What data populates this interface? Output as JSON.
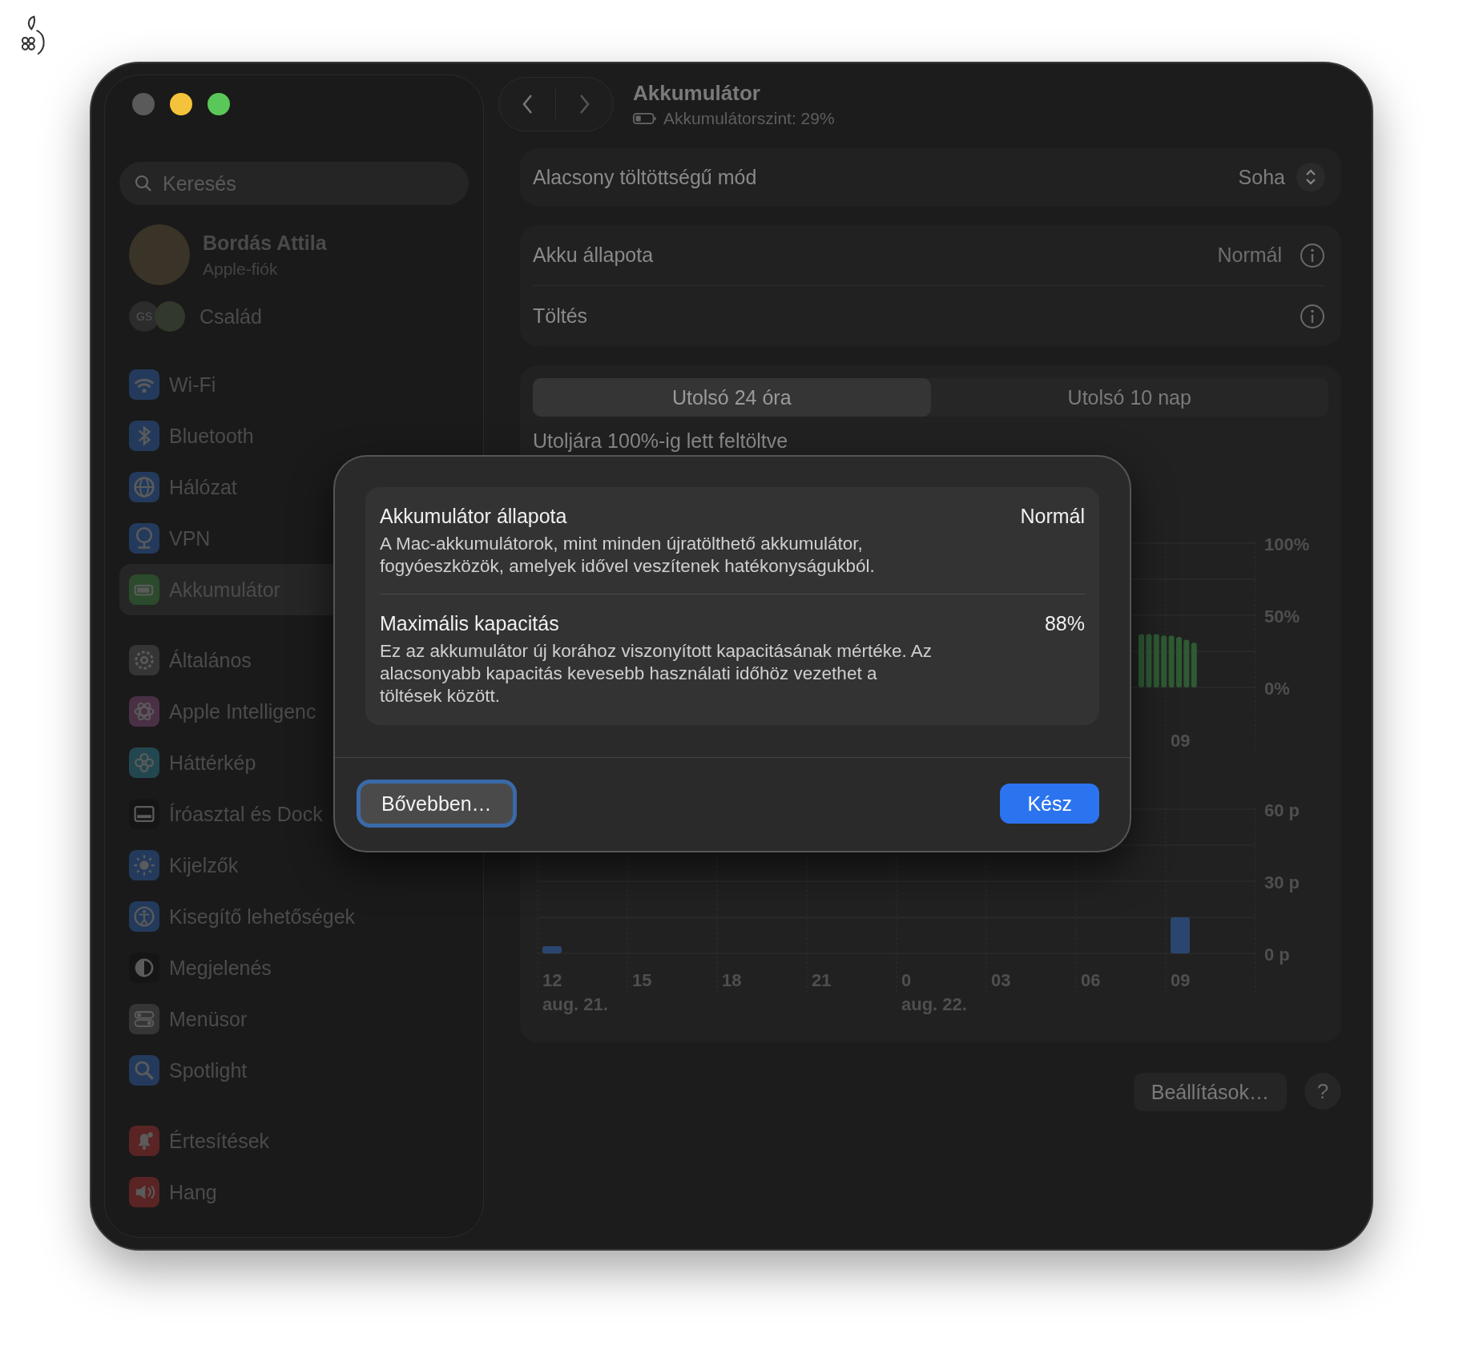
{
  "window": {
    "title": "Akkumulátor",
    "subtitle": "Akkumulátorszint: 29%"
  },
  "sidebar": {
    "search": {
      "placeholder": "Keresés"
    },
    "account": {
      "name": "Bordás Attila",
      "subtitle": "Apple-fiók"
    },
    "family": {
      "badge": "GS",
      "label": "Család"
    },
    "groups": [
      [
        {
          "label": "Wi-Fi",
          "selected": false
        },
        {
          "label": "Bluetooth",
          "selected": false
        },
        {
          "label": "Hálózat",
          "selected": false
        },
        {
          "label": "VPN",
          "selected": false
        },
        {
          "label": "Akkumulátor",
          "selected": true
        }
      ],
      [
        {
          "label": "Általános",
          "selected": false
        },
        {
          "label": "Apple Intelligenc",
          "selected": false
        },
        {
          "label": "Háttérkép",
          "selected": false
        },
        {
          "label": "Íróasztal és Dock",
          "selected": false
        },
        {
          "label": "Kijelzők",
          "selected": false
        },
        {
          "label": "Kisegítő lehetőségek",
          "selected": false
        },
        {
          "label": "Megjelenés",
          "selected": false
        },
        {
          "label": "Menüsor",
          "selected": false
        },
        {
          "label": "Spotlight",
          "selected": false
        }
      ],
      [
        {
          "label": "Értesítések",
          "selected": false
        },
        {
          "label": "Hang",
          "selected": false
        }
      ]
    ]
  },
  "low_power": {
    "label": "Alacsony töltöttségű mód",
    "value": "Soha"
  },
  "health_rows": [
    {
      "label": "Akku állapota",
      "value": "Normál"
    },
    {
      "label": "Töltés"
    }
  ],
  "range_tabs": [
    {
      "label": "Utolsó 24 óra",
      "selected": true
    },
    {
      "label": "Utolsó 10 nap",
      "selected": false
    }
  ],
  "last_charged": "Utoljára 100%-ig lett feltöltve",
  "battery_chart": {
    "chart_data": {
      "type": "bar",
      "series": [
        {
          "color": "#2f5a34",
          "values": [
            37,
            37,
            37,
            36,
            36,
            35,
            33,
            31
          ]
        }
      ],
      "ylim": [
        0,
        100
      ],
      "yticks": [
        {
          "value": 0,
          "label": "0%"
        },
        {
          "value": 50,
          "label": "50%"
        },
        {
          "value": 100,
          "label": "100%"
        }
      ],
      "annotations": [
        "09"
      ]
    }
  },
  "screen_chart": {
    "chart_data": {
      "type": "bar",
      "categories": [
        "12",
        "15",
        "18",
        "21",
        "0",
        "03",
        "06",
        "09"
      ],
      "series": [
        {
          "color": "#2a4670",
          "values": [
            3,
            null,
            null,
            null,
            null,
            null,
            null,
            15
          ]
        }
      ],
      "ylim": [
        0,
        60
      ],
      "yticks": [
        {
          "value": 0,
          "label": "0 p"
        },
        {
          "value": 30,
          "label": "30 p"
        },
        {
          "value": 60,
          "label": "60 p"
        }
      ]
    },
    "date_labels": [
      "aug. 21.",
      "aug. 22."
    ]
  },
  "footer_buttons": [
    {
      "label": "Beállítások…",
      "kind": "text"
    },
    {
      "label": "?",
      "kind": "help"
    }
  ],
  "dialog": {
    "items": [
      {
        "title": "Akkumulátor állapota",
        "value": "Normál",
        "description": "A Mac-akkumulátorok, mint minden újratölthető akkumulátor, fogyóeszközök, amelyek idővel veszítenek hatékonyságukból."
      },
      {
        "title": "Maximális kapacitás",
        "value": "88%",
        "description": "Ez az akkumulátor új korához viszonyított kapacitásának mértéke. Az alacsonyabb kapacitás kevesebb használati időhöz vezethet a töltések között."
      }
    ],
    "buttons": [
      {
        "label": "Bővebben…",
        "kind": "secondary",
        "focused": true
      },
      {
        "label": "Kész",
        "kind": "primary",
        "focused": false
      }
    ]
  }
}
